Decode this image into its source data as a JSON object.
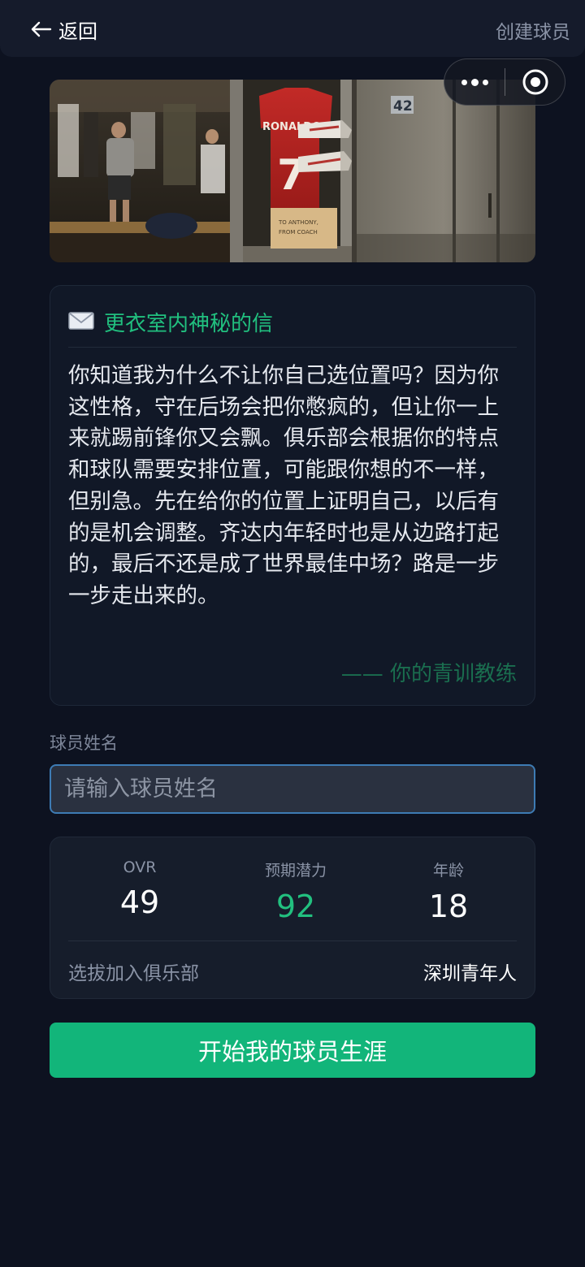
{
  "header": {
    "back_label": "返回",
    "title": "创建球员"
  },
  "capsule": {
    "more_icon": "more-dots-icon",
    "close_icon": "target-circle-icon"
  },
  "hero": {
    "scene": "locker-room",
    "jersey_name": "RONALDO",
    "jersey_number": "7",
    "locker_number": "42",
    "box_note_line1": "TO ANTHONY,",
    "box_note_line2": "FROM COACH"
  },
  "letter": {
    "icon": "envelope-icon",
    "title": "更衣室内神秘的信",
    "body": "你知道我为什么不让你自己选位置吗？因为你这性格，守在后场会把你憋疯的，但让你一上来就踢前锋你又会飘。俱乐部会根据你的特点和球队需要安排位置，可能跟你想的不一样，但别急。先在给你的位置上证明自己，以后有的是机会调整。齐达内年轻时也是从边路打起的，最后不还是成了世界最佳中场？路是一步一步走出来的。",
    "signature": "—— 你的青训教练"
  },
  "name_field": {
    "label": "球员姓名",
    "placeholder": "请输入球员姓名",
    "value": ""
  },
  "stats": {
    "ovr_label": "OVR",
    "ovr_value": "49",
    "potential_label": "预期潜力",
    "potential_value": "92",
    "age_label": "年龄",
    "age_value": "18",
    "club_label": "选拔加入俱乐部",
    "club_value": "深圳青年人"
  },
  "start_button": {
    "label": "开始我的球员生涯"
  },
  "colors": {
    "accent_green": "#12b57a",
    "title_green": "#21c07f",
    "input_border": "#3d7bb4",
    "background": "#0d1220"
  }
}
